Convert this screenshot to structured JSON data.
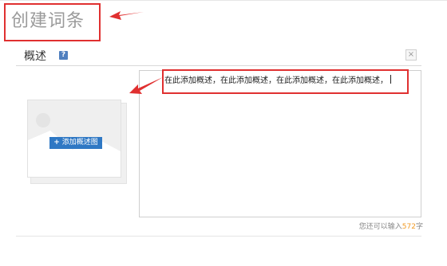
{
  "page": {
    "title": "创建词条"
  },
  "section": {
    "title": "概述",
    "help_icon": "?",
    "close_icon": "×"
  },
  "image_uploader": {
    "button_label": "添加概述图",
    "button_icon": "+"
  },
  "editor": {
    "text": "在此添加概述，在此添加概述，在此添加概述，在此添加概述，"
  },
  "counter": {
    "prefix": "您还可以输入",
    "remaining": "572",
    "suffix": "字"
  },
  "colors": {
    "annotation": "#e03030",
    "button": "#2f78c4",
    "counter_number": "#f29b25"
  }
}
